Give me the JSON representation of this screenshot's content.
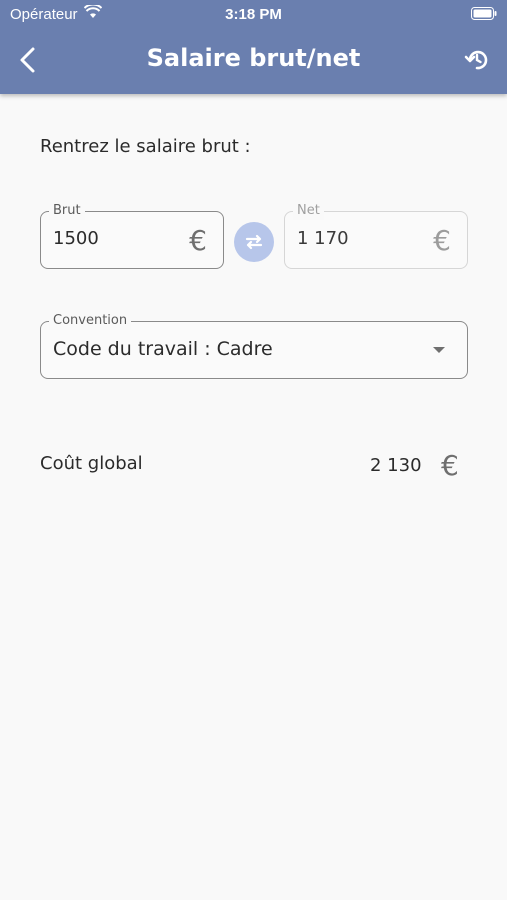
{
  "status_bar": {
    "carrier": "Opérateur",
    "time": "3:18 PM"
  },
  "nav": {
    "title": "Salaire brut/net",
    "back_icon": "chevron-left-icon",
    "history_icon": "history-icon"
  },
  "form": {
    "prompt": "Rentrez le salaire brut :",
    "brut": {
      "label": "Brut",
      "value": "1500",
      "currency": "€"
    },
    "net": {
      "label": "Net",
      "value": "1 170",
      "currency": "€"
    },
    "swap_icon": "swap-arrows-icon",
    "convention": {
      "label": "Convention",
      "value": "Code du travail : Cadre"
    }
  },
  "result": {
    "label": "Coût global",
    "value": "2 130",
    "currency": "€"
  },
  "colors": {
    "header": "#6a7faf",
    "swap_button": "#b7c6ea",
    "background": "#f9f9f9"
  }
}
